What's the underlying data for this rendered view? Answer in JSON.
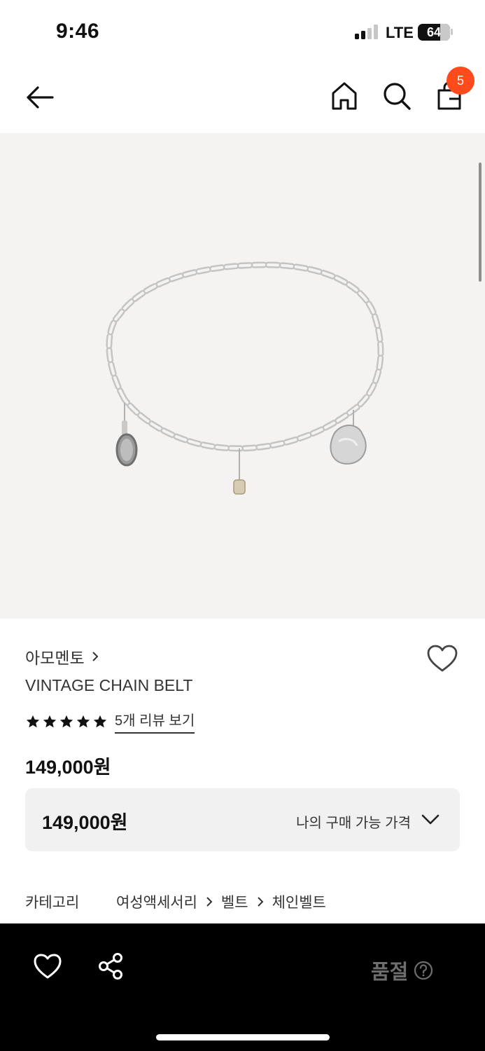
{
  "status_bar": {
    "time": "9:46",
    "network": "LTE",
    "battery": "64"
  },
  "header": {
    "cart_count": "5",
    "icons": [
      "back-arrow-icon",
      "home-icon",
      "search-icon",
      "shopping-bag-icon"
    ]
  },
  "product": {
    "image_alt": "silver chain belt with mirror, pouch and pendant charms",
    "brand": "아모멘토",
    "name": "VINTAGE CHAIN BELT",
    "rating_stars": 5,
    "review_link": "5개 리뷰 보기",
    "price": "149,000원"
  },
  "my_price": {
    "value": "149,000원",
    "label": "나의 구매 가능 가격"
  },
  "category": {
    "label": "카테고리",
    "path": [
      "여성액세서리",
      "벨트",
      "체인벨트"
    ]
  },
  "bottom_bar": {
    "status": "품절"
  },
  "colors": {
    "badge": "#ff4a1c",
    "image_bg": "#f4f3f1",
    "bottom_bar": "#000000",
    "soldout_text": "#6e6e6e"
  }
}
